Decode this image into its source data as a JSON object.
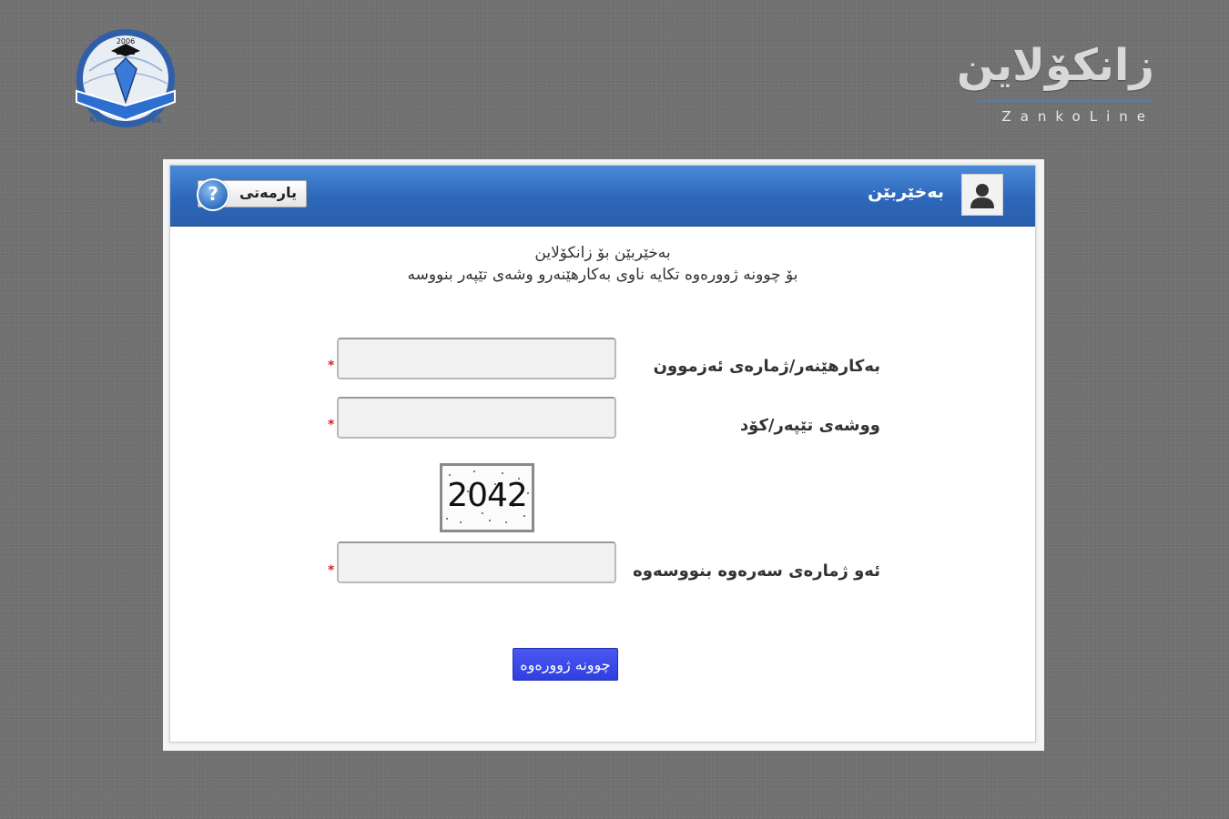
{
  "logo": {
    "year": "2006",
    "left_text": "KRG",
    "right_text": "Iraq"
  },
  "brand": {
    "title": "زانکۆلاین",
    "subtitle": "ZankoLine"
  },
  "header": {
    "title": "بەخێربێن",
    "help_label": "یارمەتی",
    "help_icon": "help-icon",
    "user_icon": "user-icon"
  },
  "welcome": {
    "line1": "بەخێربێن بۆ زانکۆلاین",
    "line2": "بۆ چوونە ژوورەوە تکایە ناوی بەکارهێنەرو وشەی تێپەر بنووسە"
  },
  "form": {
    "username_label": "بەکارهێنەر/ژمارەی ئەزموون",
    "password_label": "ووشەی تێپەر/کۆد",
    "captcha_label": "ئەو ژمارەی سەرەوە بنووسەوە",
    "captcha_code": "2042",
    "required_mark": "*",
    "username_value": "",
    "password_value": "",
    "captcha_value": "",
    "submit_label": "چوونە ژوورەوە"
  },
  "colors": {
    "header": "#2d67b8",
    "button": "#3a48e8",
    "required": "#e02020",
    "background": "#707070"
  }
}
